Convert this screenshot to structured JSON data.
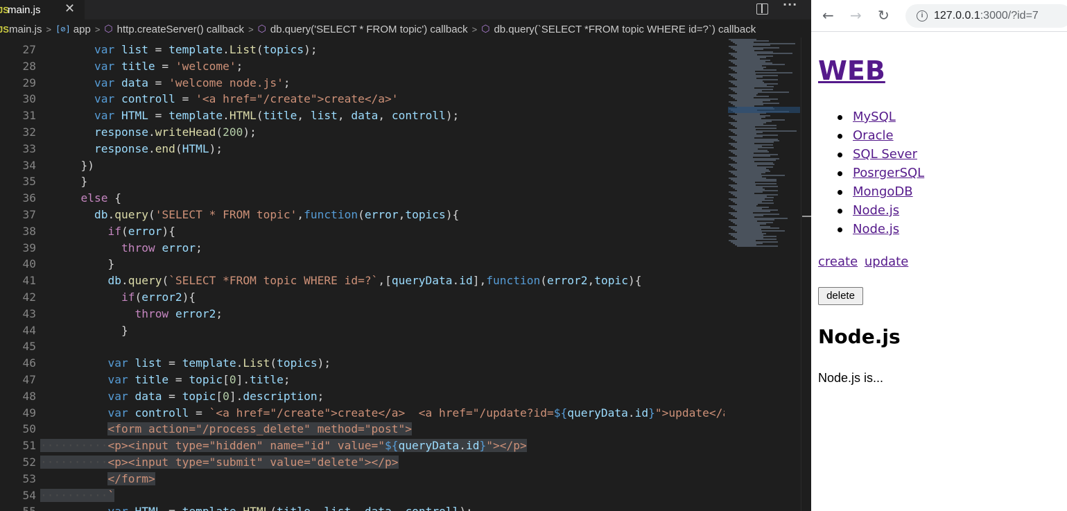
{
  "editor": {
    "tab_badge": "JS",
    "tab_label": "main.js",
    "close_glyph": "✕",
    "more_glyph": "···",
    "breadcrumb": [
      {
        "label": "main.js",
        "icon": "js-icon"
      },
      {
        "label": "app",
        "icon": "variable-icon"
      },
      {
        "label": "http.createServer() callback",
        "icon": "cube-icon"
      },
      {
        "label": "db.query('SELECT * FROM topic') callback",
        "icon": "cube-icon"
      },
      {
        "label": "db.query(`SELECT *FROM topic WHERE id=?`) callback",
        "icon": "cube-icon"
      }
    ],
    "lines": [
      {
        "n": "27",
        "sel": false,
        "tokens": [
          [
            "ws",
            "    "
          ],
          [
            "pn",
            "    "
          ],
          [
            "kw",
            "var "
          ],
          [
            "vr",
            "list"
          ],
          [
            "pn",
            " = "
          ],
          [
            "vr",
            "template"
          ],
          [
            "pn",
            "."
          ],
          [
            "fn",
            "List"
          ],
          [
            "pn",
            "("
          ],
          [
            "vr",
            "topics"
          ],
          [
            "pn",
            ");"
          ]
        ]
      },
      {
        "n": "28",
        "sel": false,
        "tokens": [
          [
            "pn",
            "        "
          ],
          [
            "kw",
            "var "
          ],
          [
            "vr",
            "title"
          ],
          [
            "pn",
            " = "
          ],
          [
            "st",
            "'welcome'"
          ],
          [
            "pn",
            ";"
          ]
        ]
      },
      {
        "n": "29",
        "sel": false,
        "tokens": [
          [
            "pn",
            "        "
          ],
          [
            "kw",
            "var "
          ],
          [
            "vr",
            "data"
          ],
          [
            "pn",
            " = "
          ],
          [
            "st",
            "'welcome node.js'"
          ],
          [
            "pn",
            ";"
          ]
        ]
      },
      {
        "n": "30",
        "sel": false,
        "tokens": [
          [
            "pn",
            "        "
          ],
          [
            "kw",
            "var "
          ],
          [
            "vr",
            "controll"
          ],
          [
            "pn",
            " = "
          ],
          [
            "st",
            "'<a href=\"/create\">create</a>'"
          ]
        ]
      },
      {
        "n": "31",
        "sel": false,
        "tokens": [
          [
            "pn",
            "        "
          ],
          [
            "kw",
            "var "
          ],
          [
            "vr",
            "HTML"
          ],
          [
            "pn",
            " = "
          ],
          [
            "vr",
            "template"
          ],
          [
            "pn",
            "."
          ],
          [
            "fn",
            "HTML"
          ],
          [
            "pn",
            "("
          ],
          [
            "vr",
            "title"
          ],
          [
            "pn",
            ", "
          ],
          [
            "vr",
            "list"
          ],
          [
            "pn",
            ", "
          ],
          [
            "vr",
            "data"
          ],
          [
            "pn",
            ", "
          ],
          [
            "vr",
            "controll"
          ],
          [
            "pn",
            ");"
          ]
        ]
      },
      {
        "n": "32",
        "sel": false,
        "tokens": [
          [
            "pn",
            "        "
          ],
          [
            "vr",
            "response"
          ],
          [
            "pn",
            "."
          ],
          [
            "fn",
            "writeHead"
          ],
          [
            "pn",
            "("
          ],
          [
            "nm",
            "200"
          ],
          [
            "pn",
            ");"
          ]
        ]
      },
      {
        "n": "33",
        "sel": false,
        "tokens": [
          [
            "pn",
            "        "
          ],
          [
            "vr",
            "response"
          ],
          [
            "pn",
            "."
          ],
          [
            "fn",
            "end"
          ],
          [
            "pn",
            "("
          ],
          [
            "vr",
            "HTML"
          ],
          [
            "pn",
            ");"
          ]
        ]
      },
      {
        "n": "34",
        "sel": false,
        "tokens": [
          [
            "pn",
            "      })"
          ]
        ]
      },
      {
        "n": "35",
        "sel": false,
        "tokens": [
          [
            "pn",
            "      }"
          ]
        ]
      },
      {
        "n": "36",
        "sel": false,
        "tokens": [
          [
            "pn",
            "      "
          ],
          [
            "ctl",
            "else"
          ],
          [
            "pn",
            " {"
          ]
        ]
      },
      {
        "n": "37",
        "sel": false,
        "tokens": [
          [
            "pn",
            "        "
          ],
          [
            "vr",
            "db"
          ],
          [
            "pn",
            "."
          ],
          [
            "fn",
            "query"
          ],
          [
            "pn",
            "("
          ],
          [
            "st",
            "'SELECT * FROM topic'"
          ],
          [
            "pn",
            ","
          ],
          [
            "kw",
            "function"
          ],
          [
            "pn",
            "("
          ],
          [
            "vr",
            "error"
          ],
          [
            "pn",
            ","
          ],
          [
            "vr",
            "topics"
          ],
          [
            "pn",
            "){"
          ]
        ]
      },
      {
        "n": "38",
        "sel": false,
        "tokens": [
          [
            "pn",
            "          "
          ],
          [
            "ctl",
            "if"
          ],
          [
            "pn",
            "("
          ],
          [
            "vr",
            "error"
          ],
          [
            "pn",
            "){"
          ]
        ]
      },
      {
        "n": "39",
        "sel": false,
        "tokens": [
          [
            "pn",
            "            "
          ],
          [
            "ctl",
            "throw "
          ],
          [
            "vr",
            "error"
          ],
          [
            "pn",
            ";"
          ]
        ]
      },
      {
        "n": "40",
        "sel": false,
        "tokens": [
          [
            "pn",
            "          }"
          ]
        ]
      },
      {
        "n": "41",
        "sel": false,
        "tokens": [
          [
            "pn",
            "          "
          ],
          [
            "vr",
            "db"
          ],
          [
            "pn",
            "."
          ],
          [
            "fn",
            "query"
          ],
          [
            "pn",
            "("
          ],
          [
            "st",
            "`SELECT *FROM topic WHERE id=?`"
          ],
          [
            "pn",
            ",["
          ],
          [
            "vr",
            "queryData"
          ],
          [
            "pn",
            "."
          ],
          [
            "vr",
            "id"
          ],
          [
            "pn",
            "],"
          ],
          [
            "kw",
            "function"
          ],
          [
            "pn",
            "("
          ],
          [
            "vr",
            "error2"
          ],
          [
            "pn",
            ","
          ],
          [
            "vr",
            "topic"
          ],
          [
            "pn",
            "){"
          ]
        ]
      },
      {
        "n": "42",
        "sel": false,
        "tokens": [
          [
            "pn",
            "            "
          ],
          [
            "ctl",
            "if"
          ],
          [
            "pn",
            "("
          ],
          [
            "vr",
            "error2"
          ],
          [
            "pn",
            "){"
          ]
        ]
      },
      {
        "n": "43",
        "sel": false,
        "tokens": [
          [
            "pn",
            "              "
          ],
          [
            "ctl",
            "throw "
          ],
          [
            "vr",
            "error2"
          ],
          [
            "pn",
            ";"
          ]
        ]
      },
      {
        "n": "44",
        "sel": false,
        "tokens": [
          [
            "pn",
            "            }"
          ]
        ]
      },
      {
        "n": "45",
        "sel": false,
        "tokens": [
          [
            "pn",
            ""
          ]
        ]
      },
      {
        "n": "46",
        "sel": false,
        "tokens": [
          [
            "pn",
            "          "
          ],
          [
            "kw",
            "var "
          ],
          [
            "vr",
            "list"
          ],
          [
            "pn",
            " = "
          ],
          [
            "vr",
            "template"
          ],
          [
            "pn",
            "."
          ],
          [
            "fn",
            "List"
          ],
          [
            "pn",
            "("
          ],
          [
            "vr",
            "topics"
          ],
          [
            "pn",
            ");"
          ]
        ]
      },
      {
        "n": "47",
        "sel": false,
        "tokens": [
          [
            "pn",
            "          "
          ],
          [
            "kw",
            "var "
          ],
          [
            "vr",
            "title"
          ],
          [
            "pn",
            " = "
          ],
          [
            "vr",
            "topic"
          ],
          [
            "pn",
            "["
          ],
          [
            "nm",
            "0"
          ],
          [
            "pn",
            "]."
          ],
          [
            "vr",
            "title"
          ],
          [
            "pn",
            ";"
          ]
        ]
      },
      {
        "n": "48",
        "sel": false,
        "tokens": [
          [
            "pn",
            "          "
          ],
          [
            "kw",
            "var "
          ],
          [
            "vr",
            "data"
          ],
          [
            "pn",
            " = "
          ],
          [
            "vr",
            "topic"
          ],
          [
            "pn",
            "["
          ],
          [
            "nm",
            "0"
          ],
          [
            "pn",
            "]."
          ],
          [
            "vr",
            "description"
          ],
          [
            "pn",
            ";"
          ]
        ]
      },
      {
        "n": "49",
        "sel": false,
        "tokens": [
          [
            "pn",
            "          "
          ],
          [
            "kw",
            "var "
          ],
          [
            "vr",
            "controll"
          ],
          [
            "pn",
            " = "
          ],
          [
            "st",
            "`<a href=\"/create\">create</a>  <a href=\"/update?id="
          ],
          [
            "kw",
            "${"
          ],
          [
            "vr",
            "queryData"
          ],
          [
            "pn",
            "."
          ],
          [
            "vr",
            "id"
          ],
          [
            "kw",
            "}"
          ],
          [
            "st",
            "\">update</a>"
          ]
        ]
      },
      {
        "n": "50",
        "sel": true,
        "tokens": [
          [
            "pn",
            "          "
          ],
          [
            "st",
            "<form action=\"/process_delete\" method=\"post\">"
          ]
        ]
      },
      {
        "n": "51",
        "sel": true,
        "tokens": [
          [
            "ws",
            "····"
          ],
          [
            "ws",
            "······"
          ],
          [
            "st",
            "<p><input type=\"hidden\" name=\"id\" value=\""
          ],
          [
            "kw",
            "${"
          ],
          [
            "vr",
            "queryData"
          ],
          [
            "pn",
            "."
          ],
          [
            "vr",
            "id"
          ],
          [
            "kw",
            "}"
          ],
          [
            "st",
            "\"></p>"
          ]
        ]
      },
      {
        "n": "52",
        "sel": true,
        "tokens": [
          [
            "ws",
            "····"
          ],
          [
            "ws",
            "······"
          ],
          [
            "st",
            "<p><input type=\"submit\" value=\"delete\"></p>"
          ]
        ]
      },
      {
        "n": "53",
        "sel": true,
        "tokens": [
          [
            "pn",
            "          "
          ],
          [
            "st",
            "</form>"
          ]
        ]
      },
      {
        "n": "54",
        "sel": true,
        "tokens": [
          [
            "ws",
            "····"
          ],
          [
            "ws",
            "······"
          ],
          [
            "st",
            "`"
          ]
        ]
      },
      {
        "n": "55",
        "sel": false,
        "tokens": [
          [
            "pn",
            "          "
          ],
          [
            "kw",
            "var "
          ],
          [
            "vr",
            "HTML"
          ],
          [
            "pn",
            " = "
          ],
          [
            "vr",
            "template"
          ],
          [
            "pn",
            "."
          ],
          [
            "fn",
            "HTML"
          ],
          [
            "pn",
            "("
          ],
          [
            "vr",
            "title"
          ],
          [
            "pn",
            ", "
          ],
          [
            "vr",
            "list"
          ],
          [
            "pn",
            ", "
          ],
          [
            "vr",
            "data"
          ],
          [
            "pn",
            ", "
          ],
          [
            "vr",
            "controll"
          ],
          [
            "pn",
            ");"
          ]
        ]
      }
    ]
  },
  "browser": {
    "nav": {
      "back": "←",
      "forward": "→",
      "reload": "↻",
      "info": "i"
    },
    "url_host": "127.0.0.1",
    "url_rest": ":3000/?id=7",
    "site_title": "WEB",
    "topics": [
      "MySQL",
      "Oracle",
      "SQL Sever",
      "PosrgerSQL",
      "MongoDB",
      "Node.js",
      "Node.js"
    ],
    "links": {
      "create": "create",
      "update": "update"
    },
    "delete_button": "delete",
    "topic_title": "Node.js",
    "topic_description": "Node.js is..."
  },
  "colors": {
    "editor_bg": "#1e1e1e",
    "keyword": "#569cd6",
    "control": "#c586c0",
    "variable": "#9cdcfe",
    "function": "#dcdcaa",
    "string": "#ce9178",
    "number": "#b5cea8",
    "link": "#551a8b"
  }
}
